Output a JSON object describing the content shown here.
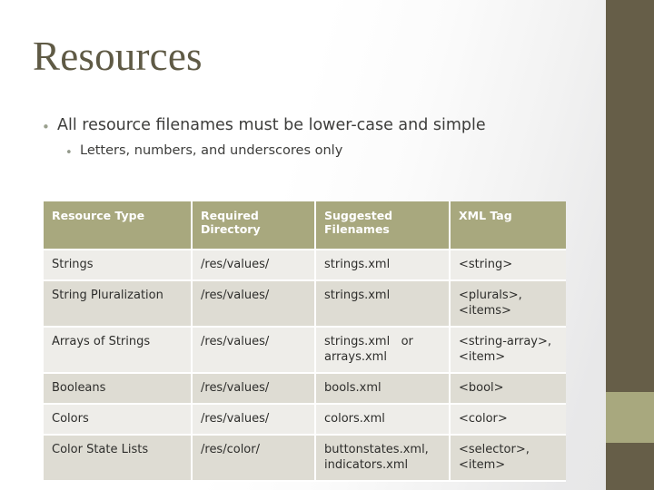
{
  "slide": {
    "title": "Resources",
    "bullets": [
      {
        "level": 1,
        "marker": "•",
        "text": "All resource filenames must be lower-case and simple"
      },
      {
        "level": 2,
        "marker": "•",
        "text": "Letters, numbers, and underscores only"
      }
    ]
  },
  "colors": {
    "accent_dark": "#665e48",
    "accent_light": "#a8a87e",
    "title_text": "#5f5a45",
    "row_alt": "#dedcd3",
    "row_norm": "#eeede9",
    "header_text": "#ffffff",
    "body_text": "#2e2e2c"
  },
  "table": {
    "headers": [
      "Resource Type",
      "Required Directory",
      "Suggested Filenames",
      "XML Tag"
    ],
    "header_lines": [
      [
        "Resource Type"
      ],
      [
        "Required",
        "Directory"
      ],
      [
        "Suggested",
        "Filenames"
      ],
      [
        "XML Tag"
      ]
    ],
    "rows": [
      {
        "resource_type": "Strings",
        "required_directory": "/res/values/",
        "suggested_filenames": [
          "strings.xml"
        ],
        "xml_tag": [
          "<string>"
        ]
      },
      {
        "resource_type": "String Pluralization",
        "required_directory": "/res/values/",
        "suggested_filenames": [
          "strings.xml"
        ],
        "xml_tag": [
          "<plurals>,",
          "<items>"
        ]
      },
      {
        "resource_type": "Arrays of Strings",
        "required_directory": "/res/values/",
        "suggested_filenames": [
          "strings.xml   or",
          "arrays.xml"
        ],
        "xml_tag": [
          "<string-array>,",
          "<item>"
        ]
      },
      {
        "resource_type": "Booleans",
        "required_directory": "/res/values/",
        "suggested_filenames": [
          "bools.xml"
        ],
        "xml_tag": [
          "<bool>"
        ]
      },
      {
        "resource_type": "Colors",
        "required_directory": "/res/values/",
        "suggested_filenames": [
          "colors.xml"
        ],
        "xml_tag": [
          "<color>"
        ]
      },
      {
        "resource_type": "Color State Lists",
        "required_directory": "/res/color/",
        "suggested_filenames": [
          "buttonstates.xml,",
          "indicators.xml"
        ],
        "xml_tag": [
          "<selector>,",
          "<item>"
        ]
      }
    ]
  }
}
